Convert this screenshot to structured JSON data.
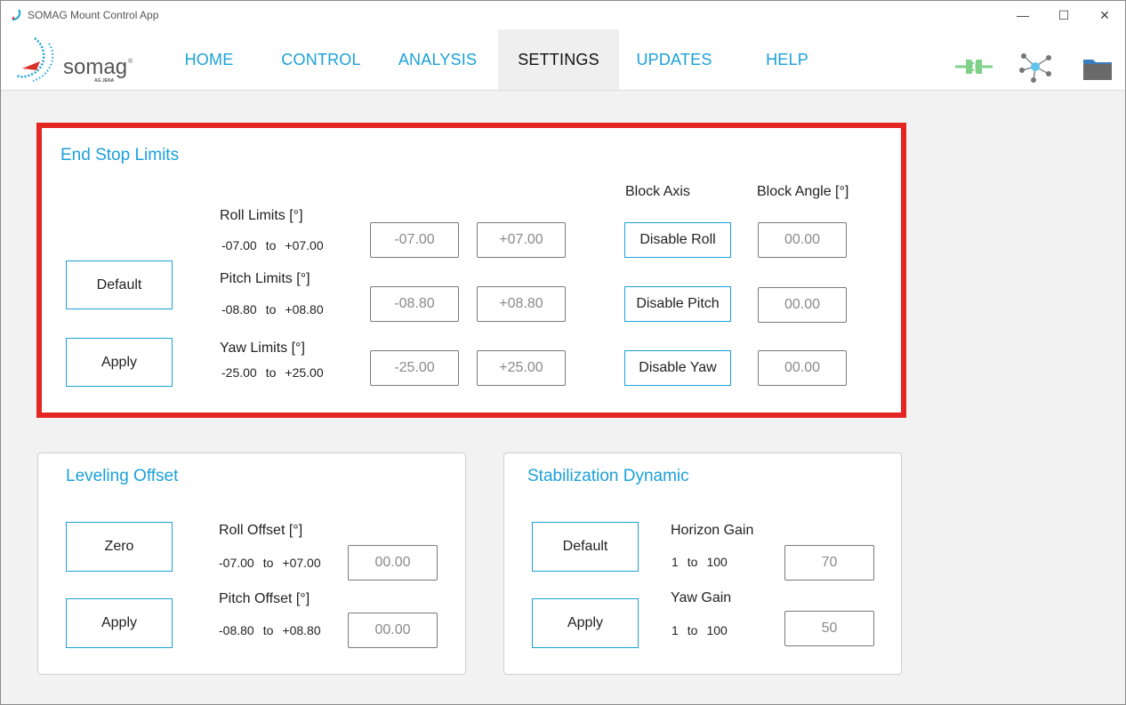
{
  "window": {
    "title": "SOMAG Mount Control App",
    "minimize": "—",
    "maximize": "☐",
    "close": "✕"
  },
  "logo": {
    "name": "somag",
    "subtitle": "AG JENA",
    "registered": "®"
  },
  "nav": {
    "tabs": [
      {
        "label": "HOME"
      },
      {
        "label": "CONTROL"
      },
      {
        "label": "ANALYSIS"
      },
      {
        "label": "SETTINGS",
        "active": true
      },
      {
        "label": "UPDATES"
      },
      {
        "label": "HELP"
      }
    ],
    "icons": [
      "plug-connection-icon",
      "network-icon",
      "folder-icon"
    ]
  },
  "end_stop": {
    "title": "End Stop Limits",
    "default_label": "Default",
    "apply_label": "Apply",
    "block_axis_header": "Block Axis",
    "block_angle_header": "Block Angle [°]",
    "to": "to",
    "rows": [
      {
        "label": "Roll Limits [°]",
        "min": "-07.00",
        "max": "+07.00",
        "field_min": "-07.00",
        "field_max": "+07.00",
        "disable_label": "Disable Roll",
        "block_angle": "00.00"
      },
      {
        "label": "Pitch Limits [°]",
        "min": "-08.80",
        "max": "+08.80",
        "field_min": "-08.80",
        "field_max": "+08.80",
        "disable_label": "Disable Pitch",
        "block_angle": "00.00"
      },
      {
        "label": "Yaw Limits [°]",
        "min": "-25.00",
        "max": "+25.00",
        "field_min": "-25.00",
        "field_max": "+25.00",
        "disable_label": "Disable Yaw",
        "block_angle": "00.00"
      }
    ]
  },
  "leveling": {
    "title": "Leveling Offset",
    "zero_label": "Zero",
    "apply_label": "Apply",
    "to": "to",
    "rows": [
      {
        "label": "Roll Offset [°]",
        "min": "-07.00",
        "max": "+07.00",
        "value": "00.00"
      },
      {
        "label": "Pitch Offset [°]",
        "min": "-08.80",
        "max": "+08.80",
        "value": "00.00"
      }
    ]
  },
  "stabilization": {
    "title": "Stabilization Dynamic",
    "default_label": "Default",
    "apply_label": "Apply",
    "to": "to",
    "rows": [
      {
        "label": "Horizon Gain",
        "min": "1",
        "max": "100",
        "value": "70"
      },
      {
        "label": "Yaw Gain",
        "min": "1",
        "max": "100",
        "value": "50"
      }
    ]
  },
  "colors": {
    "accent": "#1ba1d9",
    "highlight": "#e42622",
    "plug_green": "#7fd18a"
  }
}
